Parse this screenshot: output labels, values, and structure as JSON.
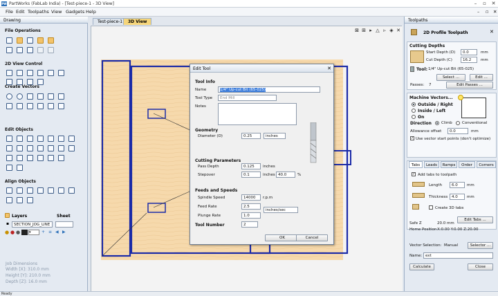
{
  "window": {
    "title": "PartWorks (FabLab India) - [Test-piece-1 - 3D View]",
    "logo_text": "PW"
  },
  "menu": [
    "File",
    "Edit",
    "Toolpaths",
    "View",
    "Gadgets",
    "Help"
  ],
  "left_panel": {
    "title": "Drawing",
    "sections": {
      "file_ops": "File Operations",
      "view_ctrl": "2D View Control",
      "create_vectors": "Create Vectors",
      "edit_objects": "Edit Objects",
      "align_objects": "Align Objects"
    },
    "layers_label": "Layers",
    "sheet_label": "Sheet",
    "layer_name": "SECTION_JOG_LINE",
    "job_dims": {
      "title": "Job Dimensions",
      "width": "Width  [X]: 310.0 mm",
      "height": "Height [Y]: 210.0 mm",
      "depth": "Depth  [Z]: 16.0 mm"
    }
  },
  "view": {
    "tabs": [
      "Test-piece-1",
      "3D View"
    ],
    "active_tab": 1
  },
  "dialog": {
    "title": "Edit Tool",
    "tool_info": "Tool Info",
    "name_label": "Name",
    "name_value": "1/4\" Up-cut Bit (65-025)",
    "tool_type_label": "Tool Type",
    "tool_type_value": "End Mill",
    "notes_label": "Notes",
    "geometry": "Geometry",
    "diameter_label": "Diameter (D)",
    "diameter_value": "0.25",
    "units_value": "inches",
    "cutting": "Cutting Parameters",
    "pass_depth_label": "Pass Depth",
    "pass_depth_value": "0.125",
    "pass_depth_unit": "inches",
    "stepover_label": "Stepover",
    "stepover_value": "0.1",
    "stepover_unit": "inches",
    "stepover_pct": "40.0",
    "pct_sign": "%",
    "feeds": "Feeds and Speeds",
    "spindle_label": "Spindle Speed",
    "spindle_value": "14000",
    "spindle_unit": "r.p.m",
    "feed_label": "Feed Rate",
    "feed_value": "2.5",
    "rate_units": "inches/sec",
    "plunge_label": "Plunge Rate",
    "plunge_value": "1.0",
    "tool_number_label": "Tool Number",
    "tool_number_value": "2",
    "ok": "OK",
    "cancel": "Cancel"
  },
  "right_panel": {
    "title": "Toolpaths",
    "heading": "2D Profile Toolpath",
    "cutting_depths": "Cutting Depths",
    "start_depth_label": "Start Depth (D)",
    "start_depth_value": "0.0",
    "start_depth_unit": "mm",
    "cut_depth_label": "Cut Depth (C)",
    "cut_depth_value": "16.2",
    "cut_depth_unit": "mm",
    "tool_label": "Tool:",
    "tool_value": "1/4\" Up-cut Bit (65-025)",
    "select_btn": "Select ...",
    "edit_btn": "Edit ...",
    "passes_label": "Passes:",
    "passes_value": "7",
    "edit_passes_btn": "Edit Passes ...",
    "machine_vectors": "Machine Vectors...",
    "outside": "Outside / Right",
    "inside": "Inside / Left",
    "on": "On",
    "direction_label": "Direction",
    "climb": "Climb",
    "conventional": "Conventional",
    "allowance_label": "Allowance offset",
    "allowance_value": "0.0",
    "allowance_unit": "mm",
    "use_start_points": "Use vector start points (don't optimize)",
    "tabs": [
      "Tabs",
      "Leads",
      "Ramps",
      "Order",
      "Corners"
    ],
    "add_tabs": "Add tabs to toolpath",
    "length_label": "Length",
    "length_value": "6.0",
    "length_unit": "mm",
    "thickness_label": "Thickness",
    "thickness_value": "4.0",
    "thickness_unit": "mm",
    "create_3d_tabs": "Create 3D tabs",
    "edit_tabs_btn": "Edit Tabs ...",
    "safe_z_label": "Safe Z",
    "safe_z_value": "20.0 mm",
    "home_label": "Home Position",
    "home_value": "X:0.00 Y:0.00 Z:20.00",
    "vector_sel_label": "Vector Selection:",
    "vector_sel_value": "Manual",
    "selector_btn": "Selector ...",
    "name_label": "Name:",
    "name_value": "ext",
    "calculate": "Calculate",
    "close": "Close"
  },
  "status": "Ready"
}
